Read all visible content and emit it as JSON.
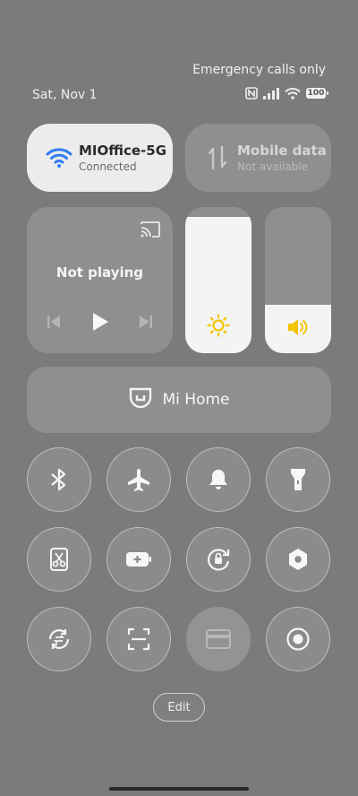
{
  "status_bar": {
    "emergency": "Emergency calls only",
    "date": "Sat, Nov 1",
    "battery": "100"
  },
  "wifi_tile": {
    "title": "MIOffice-5G",
    "subtitle": "Connected",
    "accent": "#2f7cf6"
  },
  "mobile_tile": {
    "title": "Mobile data",
    "subtitle": "Not available"
  },
  "media": {
    "status": "Not playing"
  },
  "sliders": {
    "brightness": {
      "level": 0.93
    },
    "volume": {
      "level": 0.33,
      "icon_color": "#f5c400"
    }
  },
  "mihome": {
    "label": "Mi Home"
  },
  "toggles": [
    "bluetooth-icon",
    "airplane-icon",
    "bell-icon",
    "flashlight-icon",
    "scissors-icon",
    "battery-saver-icon",
    "rotation-lock-icon",
    "settings-hex-icon",
    "sync-icon",
    "scan-icon",
    "card-icon",
    "record-icon"
  ],
  "edit": {
    "label": "Edit"
  }
}
